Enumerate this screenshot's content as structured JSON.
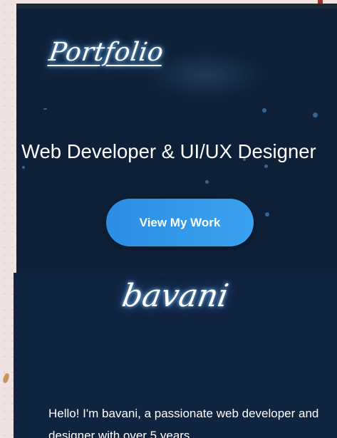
{
  "hero": {
    "logo_text": "Portfolio",
    "title": "Web Developer & UI/UX Designer",
    "cta_label": "View My Work"
  },
  "about": {
    "name": "bavani",
    "bio": "Hello! I'm bavani, a passionate web developer and designer with over 5 years"
  },
  "colors": {
    "page_background": "#efe4e1",
    "hero_background": "#0d2037",
    "about_background": "#10233f",
    "accent_blue": "#2b8de3",
    "glow_blue": "#46a0ff",
    "text": "#ffffff"
  }
}
